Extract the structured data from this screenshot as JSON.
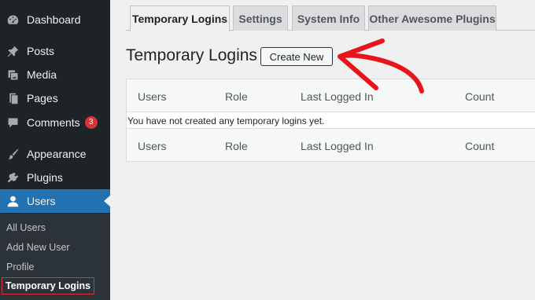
{
  "sidebar": {
    "items": [
      {
        "label": "Dashboard",
        "icon": "dashboard-icon"
      },
      {
        "label": "Posts",
        "icon": "pin-icon"
      },
      {
        "label": "Media",
        "icon": "media-icon"
      },
      {
        "label": "Pages",
        "icon": "pages-icon"
      },
      {
        "label": "Comments",
        "icon": "comment-icon",
        "badge": "3"
      },
      {
        "label": "Appearance",
        "icon": "brush-icon"
      },
      {
        "label": "Plugins",
        "icon": "plug-icon"
      },
      {
        "label": "Users",
        "icon": "user-icon",
        "active": true
      }
    ],
    "submenu": [
      {
        "label": "All Users"
      },
      {
        "label": "Add New User"
      },
      {
        "label": "Profile"
      },
      {
        "label": "Temporary Logins",
        "current": true
      }
    ]
  },
  "tabs": [
    {
      "label": "Temporary Logins",
      "active": true
    },
    {
      "label": "Settings"
    },
    {
      "label": "System Info"
    },
    {
      "label": "Other Awesome Plugins"
    }
  ],
  "main": {
    "title": "Temporary Logins",
    "create_button": "Create New",
    "columns": [
      "Users",
      "Role",
      "Last Logged In",
      "Count"
    ],
    "empty_message": "You have not created any temporary logins yet."
  },
  "colors": {
    "sidebar_bg": "#1d2327",
    "active_bg": "#2271b1",
    "badge_bg": "#d63638",
    "annotation_arrow": "#e8131b"
  }
}
